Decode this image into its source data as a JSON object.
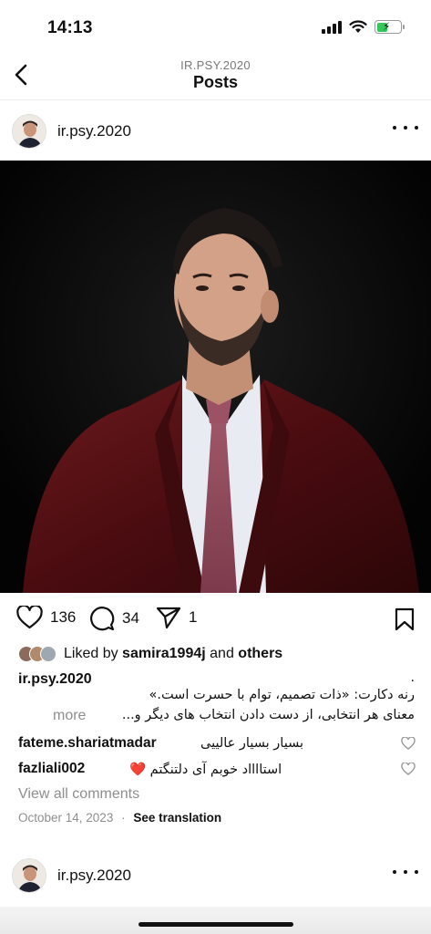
{
  "status_bar": {
    "time": "14:13",
    "battery_level_percent": 45,
    "battery_color": "#34c759"
  },
  "header": {
    "subtitle": "IR.PSY.2020",
    "title": "Posts"
  },
  "post": {
    "username": "ir.psy.2020",
    "likes_count": "136",
    "comments_count": "34",
    "shares_count": "1",
    "liked_by_prefix": "Liked by",
    "liked_by_user": "samira1994j",
    "liked_by_and": "and",
    "liked_by_others": "others",
    "caption_user": "ir.psy.2020",
    "caption_dot": ".",
    "caption_line1": "رنه دکارت: «ذات تصمیم، توام با حسرت است.»",
    "caption_line2": "معنای هر انتخابی، از دست دادن انتخاب های دیگر و...",
    "caption_more": "more",
    "comments": [
      {
        "user": "fateme.shariatmadar",
        "text": "بسیار بسیار عالییی"
      },
      {
        "user": "fazliali002",
        "text": "استااااد خوبم آی دلتنگتم ❤️"
      }
    ],
    "view_all_comments": "View all comments",
    "date": "October 14, 2023",
    "separator": "·",
    "see_translation": "See translation"
  },
  "next_post": {
    "username": "ir.psy.2020"
  },
  "icons": {
    "back": "chevron-left-icon",
    "more": "more-horizontal-icon",
    "like": "heart-icon",
    "comment": "comment-bubble-icon",
    "share": "paper-plane-icon",
    "save": "bookmark-icon"
  },
  "colors": {
    "jacket": "#5a0f14",
    "background": "#050505",
    "heart_red": "#e0245e"
  }
}
